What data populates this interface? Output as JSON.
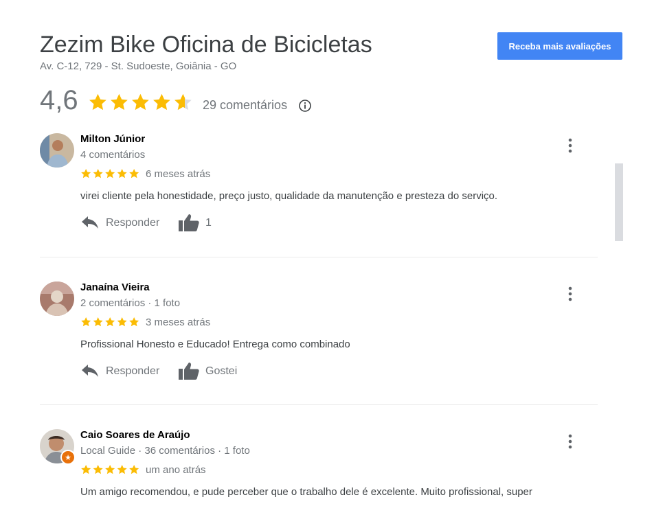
{
  "header": {
    "business_name": "Zezim Bike Oficina de Bicicletas",
    "address": "Av. C-12, 729 - St. Sudoeste, Goiânia - GO",
    "more_reviews_button": "Receba mais avaliações"
  },
  "summary": {
    "rating_text": "4,6",
    "rating_value": 4.6,
    "reviews_count": "29 comentários",
    "star_color": "#fbbc04"
  },
  "actions": {
    "reply_label": "Responder"
  },
  "reviews": [
    {
      "name": "Milton Júnior",
      "meta": "4 comentários",
      "stars": 5,
      "time": "6 meses atrás",
      "text": "virei cliente pela honestidade, preço justo, qualidade da manutenção e presteza do serviço.",
      "like_label": "1"
    },
    {
      "name": "Janaína Vieira",
      "meta": "2 comentários · 1 foto",
      "stars": 5,
      "time": "3 meses atrás",
      "text": "Profissional Honesto e Educado! Entrega como combinado",
      "like_label": "Gostei"
    },
    {
      "name": "Caio Soares de Araújo",
      "meta": "Local Guide · 36 comentários · 1 foto",
      "stars": 5,
      "time": "um ano atrás",
      "text": "Um amigo recomendou, e pude perceber que o trabalho dele é excelente. Muito profissional, super",
      "local_guide_badge_icon": "star-icon"
    }
  ]
}
